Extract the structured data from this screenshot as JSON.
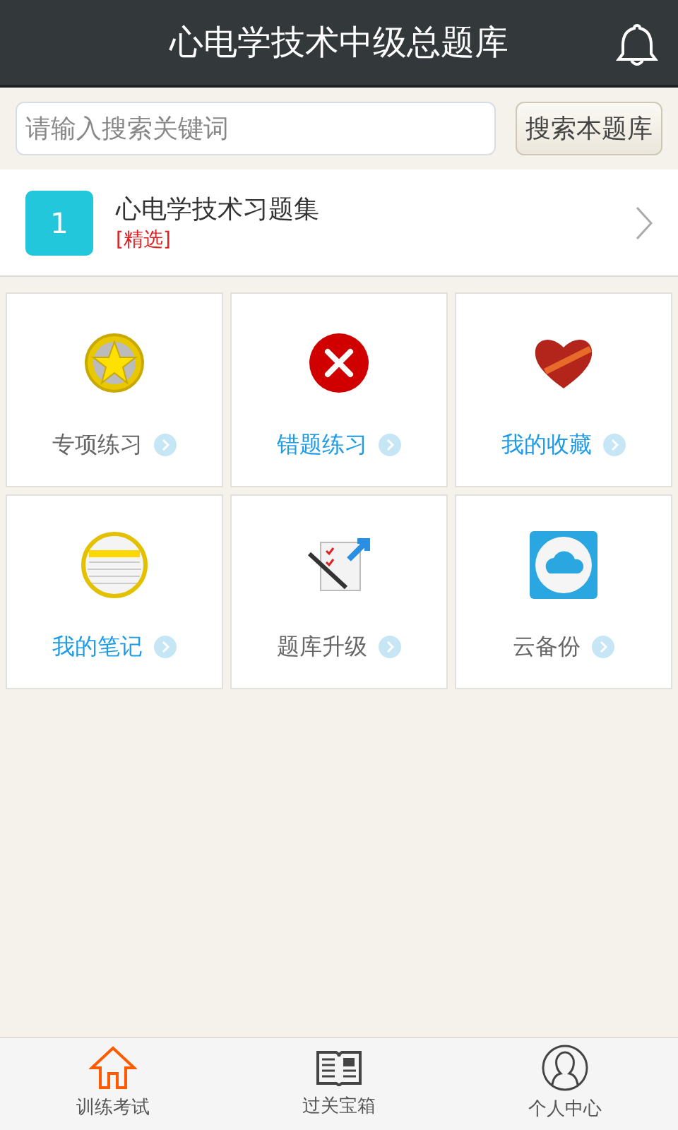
{
  "header": {
    "title": "心电学技术中级总题库"
  },
  "search": {
    "placeholder": "请输入搜索关键词",
    "button": "搜索本题库"
  },
  "banks": [
    {
      "number": "1",
      "title": "心电学技术习题集",
      "tag": "[精选]"
    }
  ],
  "tiles": [
    {
      "kind": "star",
      "label": "专项练习",
      "color": "#666666"
    },
    {
      "kind": "error",
      "label": "错题练习",
      "color": "#1e9be6"
    },
    {
      "kind": "heart",
      "label": "我的收藏",
      "color": "#1e9be6"
    },
    {
      "kind": "notes",
      "label": "我的笔记",
      "color": "#1e9be6"
    },
    {
      "kind": "upgrade",
      "label": "题库升级",
      "color": "#666666"
    },
    {
      "kind": "cloud",
      "label": "云备份",
      "color": "#666666"
    }
  ],
  "tabs": [
    {
      "kind": "home",
      "label": "训练考试",
      "selected": true
    },
    {
      "kind": "book",
      "label": "过关宝箱",
      "selected": false
    },
    {
      "kind": "person",
      "label": "个人中心",
      "selected": false
    }
  ]
}
